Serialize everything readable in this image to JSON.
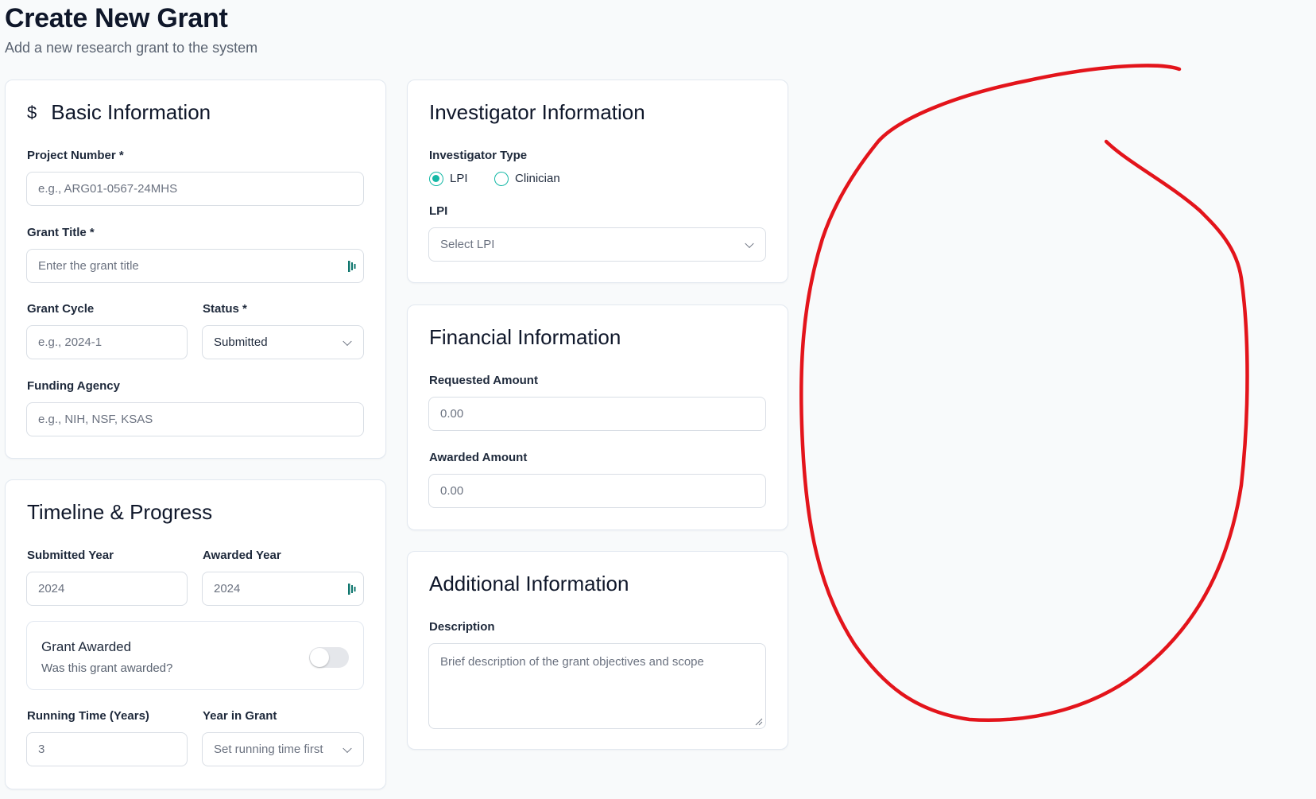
{
  "header": {
    "title": "Create New Grant",
    "subtitle": "Add a new research grant to the system"
  },
  "basic_info": {
    "title": "Basic Information",
    "icon": "dollar-icon",
    "project_number": {
      "label": "Project Number *",
      "placeholder": "e.g., ARG01-0567-24MHS"
    },
    "grant_title": {
      "label": "Grant Title *",
      "placeholder": "Enter the grant title"
    },
    "grant_cycle": {
      "label": "Grant Cycle",
      "placeholder": "e.g., 2024-1"
    },
    "status": {
      "label": "Status *",
      "value": "Submitted"
    },
    "funding_agency": {
      "label": "Funding Agency",
      "placeholder": "e.g., NIH, NSF, KSAS"
    }
  },
  "timeline": {
    "title": "Timeline & Progress",
    "submitted_year": {
      "label": "Submitted Year",
      "value": "2024"
    },
    "awarded_year": {
      "label": "Awarded Year",
      "value": "2024"
    },
    "grant_awarded": {
      "title": "Grant Awarded",
      "subtitle": "Was this grant awarded?",
      "on": false
    },
    "running_time": {
      "label": "Running Time (Years)",
      "value": "3"
    },
    "year_in_grant": {
      "label": "Year in Grant",
      "value": "Set running time first"
    }
  },
  "investigator": {
    "title": "Investigator Information",
    "type_label": "Investigator Type",
    "options": [
      "LPI",
      "Clinician"
    ],
    "selected": "LPI",
    "lpi": {
      "label": "LPI",
      "placeholder": "Select LPI"
    }
  },
  "financial": {
    "title": "Financial Information",
    "requested": {
      "label": "Requested Amount",
      "placeholder": "0.00"
    },
    "awarded": {
      "label": "Awarded Amount",
      "placeholder": "0.00"
    }
  },
  "additional": {
    "title": "Additional Information",
    "description": {
      "label": "Description",
      "placeholder": "Brief description of the grant objectives and scope"
    }
  },
  "colors": {
    "accent": "#14b8a6",
    "annotation": "#e3141b"
  }
}
